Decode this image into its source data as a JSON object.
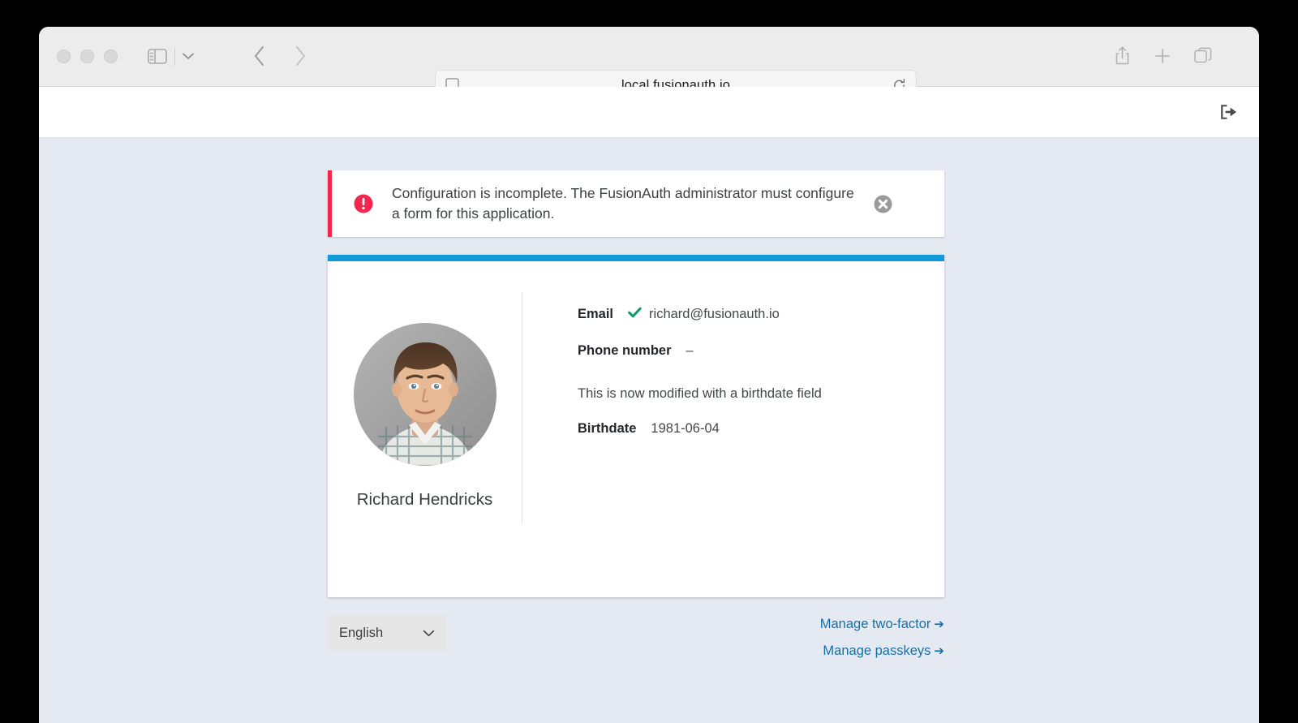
{
  "browser": {
    "url": "local.fusionauth.io",
    "icons": {
      "sidebar": "sidebar-toggle-icon",
      "sidebar_chevron": "chevron-down-icon",
      "back": "back-chevron-icon",
      "forward": "forward-chevron-icon",
      "reader": "reader-view-icon",
      "reload": "reload-icon",
      "share": "share-icon",
      "new_tab": "plus-icon",
      "tab_overview": "tab-overview-icon"
    }
  },
  "app_header": {
    "logout_icon": "logout-icon"
  },
  "alert": {
    "icon": "exclamation-circle-icon",
    "message": "Configuration is incomplete. The FusionAuth administrator must configure a form for this application.",
    "close_icon": "close-circle-icon",
    "accent_color": "#f4264e"
  },
  "card": {
    "accent_color": "#109ada",
    "profile": {
      "avatar_alt": "Richard Hendricks profile photo",
      "name": "Richard Hendricks"
    },
    "details": [
      {
        "label": "Email",
        "value": "richard@fusionauth.io",
        "verified": true
      },
      {
        "label": "Phone number",
        "value": "–",
        "verified": false
      }
    ],
    "note": "This is now modified with a birthdate field",
    "birthdate": {
      "label": "Birthdate",
      "value": "1981-06-04"
    }
  },
  "footer": {
    "language": {
      "value": "English",
      "chevron_icon": "chevron-down-icon"
    },
    "links": [
      {
        "label": "Manage two-factor",
        "arrow": "➔"
      },
      {
        "label": "Manage passkeys",
        "arrow": "➔"
      }
    ]
  }
}
